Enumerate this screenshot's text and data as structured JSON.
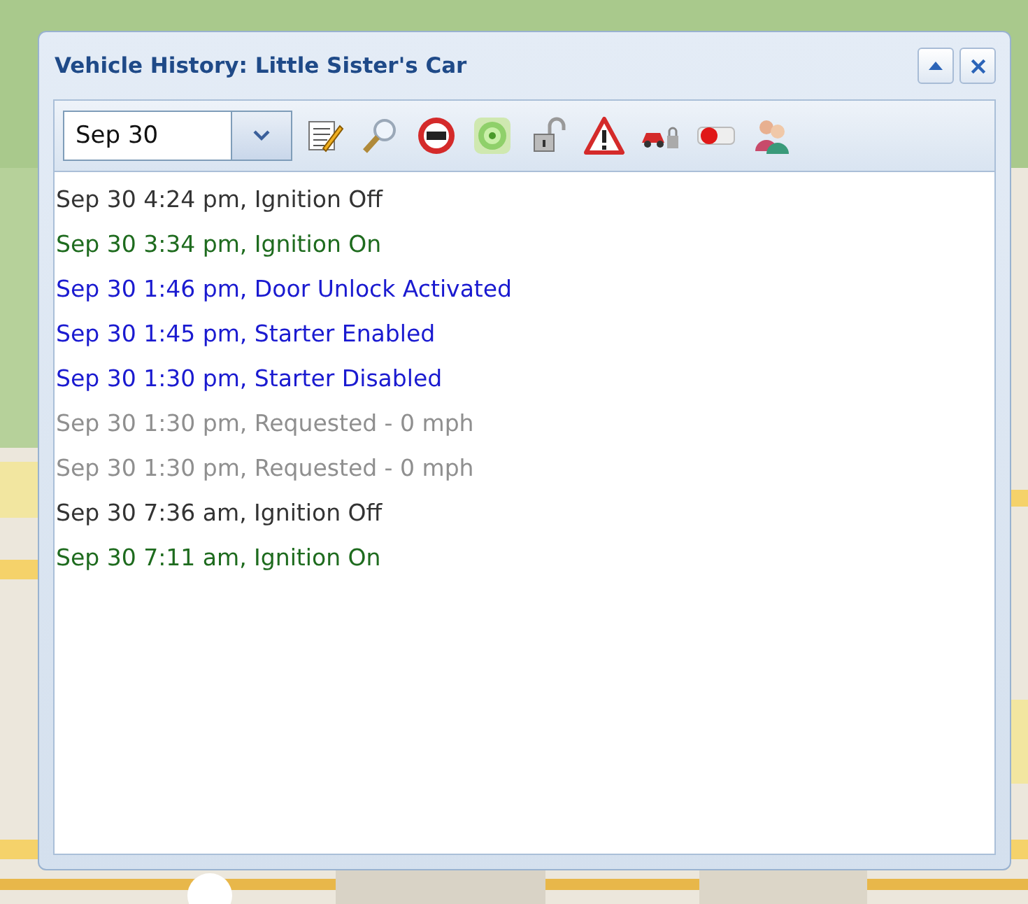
{
  "window": {
    "title": "Vehicle History: Little Sister's Car"
  },
  "window_buttons": [
    {
      "kind": "collapse"
    },
    {
      "kind": "close"
    }
  ],
  "toolbar": {
    "date": {
      "value": "Sep 30"
    },
    "tools": [
      {
        "kind": "notes"
      },
      {
        "kind": "search"
      },
      {
        "kind": "speed"
      },
      {
        "kind": "target"
      },
      {
        "kind": "lock"
      },
      {
        "kind": "warning"
      },
      {
        "kind": "car"
      },
      {
        "kind": "starter"
      },
      {
        "kind": "people"
      }
    ]
  },
  "events": [
    {
      "text": "Sep 30 4:24 pm, Ignition Off",
      "color": "#333333"
    },
    {
      "text": "Sep 30 3:34 pm, Ignition On",
      "color": "#1e6b1e"
    },
    {
      "text": "Sep 30 1:46 pm, Door Unlock Activated",
      "color": "#1a1ad0"
    },
    {
      "text": "Sep 30 1:45 pm, Starter Enabled",
      "color": "#1a1ad0"
    },
    {
      "text": "Sep 30 1:30 pm, Starter Disabled",
      "color": "#1a1ad0"
    },
    {
      "text": "Sep 30 1:30 pm, Requested - 0 mph",
      "color": "#8f8f8f"
    },
    {
      "text": "Sep 30 1:30 pm, Requested - 0 mph",
      "color": "#8f8f8f"
    },
    {
      "text": "Sep 30 7:36 am, Ignition Off",
      "color": "#333333"
    },
    {
      "text": "Sep 30 7:11 am, Ignition On",
      "color": "#1e6b1e"
    }
  ]
}
